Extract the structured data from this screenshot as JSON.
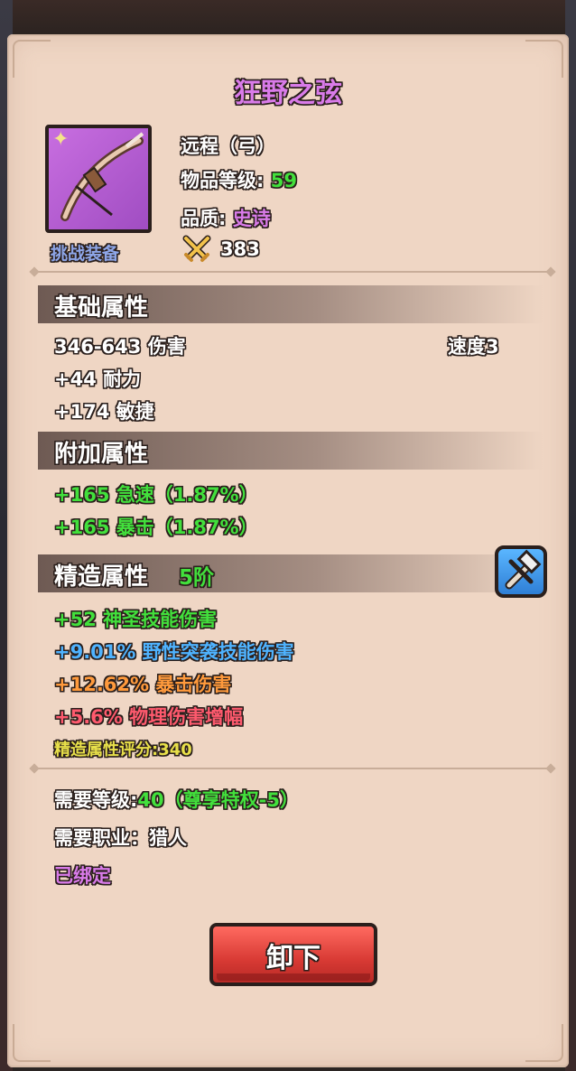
{
  "item": {
    "name": "狂野之弦",
    "type": "远程（弓）",
    "item_level_label": "物品等级:",
    "item_level": "59",
    "quality_label": "品质:",
    "quality": "史诗",
    "power": "383",
    "tag": "挑战装备",
    "icon": "bow-icon",
    "colors": {
      "epic": "#d97be9",
      "green": "#42e03c",
      "blue": "#4fb3ff",
      "orange": "#ff9a3c",
      "red": "#ff5a6e",
      "yellow": "#e8e04a"
    }
  },
  "base": {
    "title": "基础属性",
    "damage": "346-643 伤害",
    "speed": "速度3",
    "stats": [
      "+44 耐力",
      "+174 敏捷"
    ]
  },
  "bonus": {
    "title": "附加属性",
    "stats": [
      "+165 急速（1.87%）",
      "+165 暴击（1.87%）"
    ]
  },
  "refine": {
    "title": "精造属性",
    "tier": "5阶",
    "stats": [
      "+52 神圣技能伤害",
      "+9.01% 野性突袭技能伤害",
      "+12.62% 暴击伤害",
      "+5.6% 物理伤害增幅"
    ],
    "score": "精造属性评分:340"
  },
  "requirements": {
    "level_label": "需要等级:",
    "level_value": "40（尊享特权-5）",
    "class": "需要职业：猎人",
    "bound": "已绑定"
  },
  "button": {
    "unequip": "卸下"
  }
}
